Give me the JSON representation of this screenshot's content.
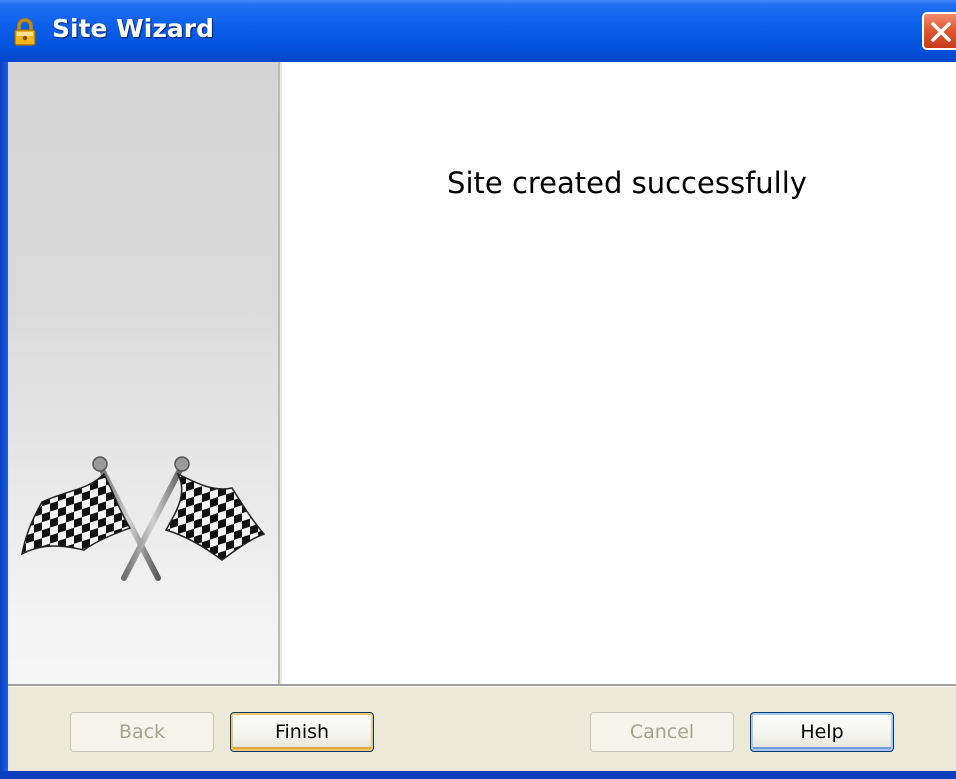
{
  "window": {
    "title": "Site Wizard",
    "title_icon": "lock-icon",
    "close_icon": "close-icon"
  },
  "side_panel": {
    "image": "checkered-flags-icon"
  },
  "content": {
    "message": "Site created successfully"
  },
  "buttons": {
    "back": "Back",
    "finish": "Finish",
    "cancel": "Cancel",
    "help": "Help"
  },
  "colors": {
    "titlebar": "#0a5fe8",
    "close_button": "#e15a30",
    "dialog_background": "#ece9d8",
    "content_background": "#ffffff"
  }
}
